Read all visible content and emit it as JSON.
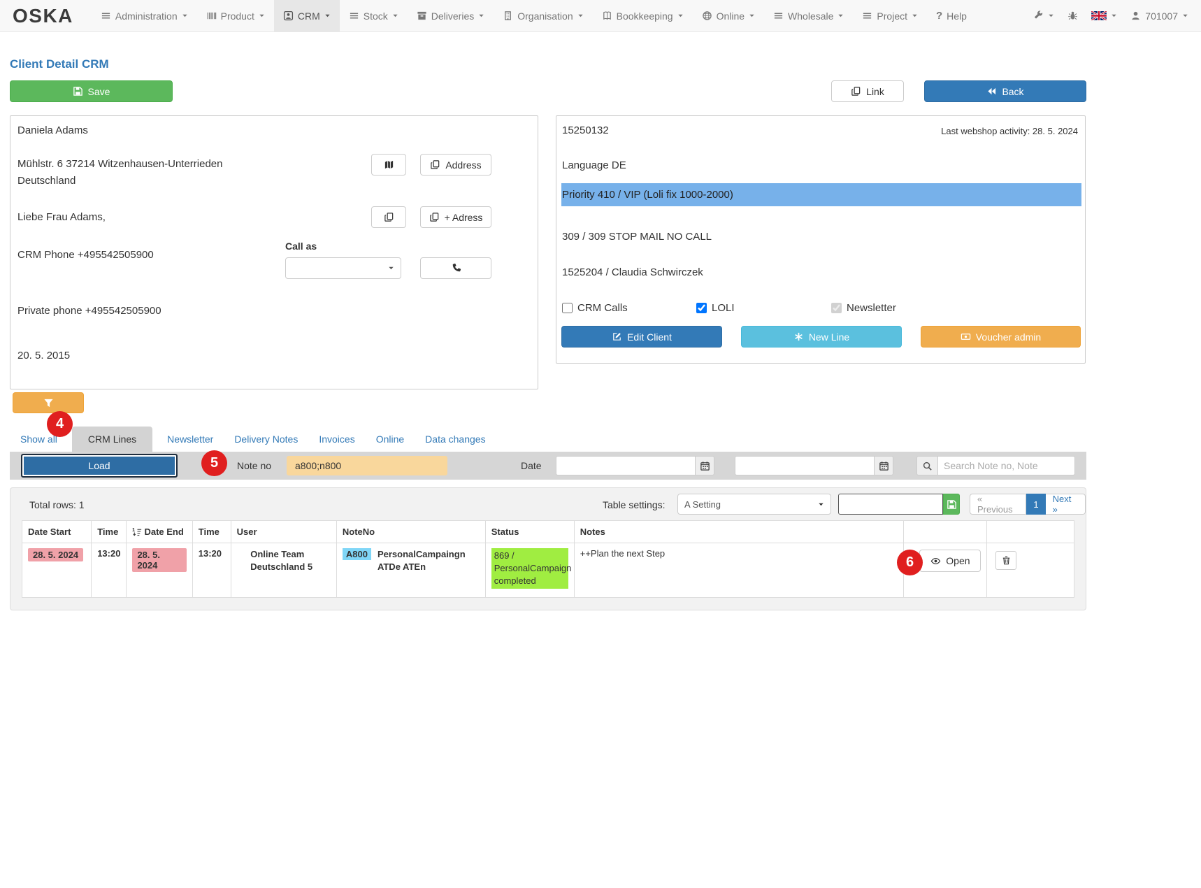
{
  "navbar": {
    "brand": "OSKA",
    "items": [
      {
        "label": "Administration"
      },
      {
        "label": "Product"
      },
      {
        "label": "CRM"
      },
      {
        "label": "Stock"
      },
      {
        "label": "Deliveries"
      },
      {
        "label": "Organisation"
      },
      {
        "label": "Bookkeeping"
      },
      {
        "label": "Online"
      },
      {
        "label": "Wholesale"
      },
      {
        "label": "Project"
      },
      {
        "label": "Help"
      }
    ],
    "user_id": "701007"
  },
  "page": {
    "title": "Client Detail CRM"
  },
  "actions": {
    "save": "Save",
    "link": "Link",
    "back": "Back"
  },
  "client": {
    "name": "Daniela Adams",
    "address_line1": "Mühlstr. 6 37214 Witzenhausen-Unterrieden",
    "address_line2": "Deutschland",
    "salutation": "Liebe Frau Adams,",
    "crm_phone": "CRM Phone +495542505900",
    "private_phone": "Private phone +495542505900",
    "client_since": "20. 5. 2015",
    "call_as_label": "Call as",
    "buttons": {
      "address": "Address",
      "add_address": "+ Adress"
    }
  },
  "account": {
    "client_no": "15250132",
    "last_activity": "Last webshop activity: 28. 5. 2024",
    "language": "Language DE",
    "priority": "Priority 410 / VIP (Loli fix 1000-2000)",
    "stop_mail": "309 / 309 STOP MAIL NO CALL",
    "contact": "1525204 / Claudia Schwirczek",
    "checkboxes": {
      "crm_calls": "CRM Calls",
      "loli": "LOLI",
      "newsletter": "Newsletter"
    },
    "buttons": {
      "edit_client": "Edit Client",
      "new_line": "New Line",
      "voucher_admin": "Voucher admin"
    }
  },
  "tabs": {
    "show_all": "Show all",
    "crm_lines": "CRM Lines",
    "newsletter": "Newsletter",
    "delivery_notes": "Delivery Notes",
    "invoices": "Invoices",
    "online": "Online",
    "data_changes": "Data changes"
  },
  "badges": {
    "step4": "4",
    "step5": "5",
    "step6": "6"
  },
  "filter": {
    "load": "Load",
    "note_no_label": "Note no",
    "note_no_value": "a800;n800",
    "date_label": "Date",
    "search_placeholder": "Search Note no, Note"
  },
  "grid": {
    "total_rows": "Total rows: 1",
    "settings_label": "Table settings:",
    "settings_value": "A Setting",
    "pagination": {
      "previous": "« Previous",
      "page": "1",
      "next": "Next »"
    },
    "headers": [
      "Date Start",
      "Time",
      "Date End",
      "Time",
      "User",
      "NoteNo",
      "Status",
      "Notes"
    ],
    "row": {
      "date_start": "28. 5. 2024",
      "time_start": "13:20",
      "date_end": "28. 5. 2024",
      "time_end": "13:20",
      "user": "Online Team Deutschland 5",
      "note_badge": "A800",
      "note_name": "PersonalCampaingn ATDe ATEn",
      "status": "869 / PersonalCampaign completed",
      "notes": "++Plan the next Step",
      "open": "Open"
    }
  },
  "colors": {
    "accent_blue": "#337ab7",
    "save_green": "#5cb85c",
    "info_cyan": "#5bc0de",
    "warn_orange": "#f0ad4e",
    "badge_red": "#e01f1f",
    "priority_blue": "#77b1ea",
    "load_blue": "#2e6da4",
    "note_input_orange": "#f9d79c",
    "date_pink": "#f0a1a8",
    "note_cyan": "#7fd6f7",
    "status_green": "#a0ed41"
  }
}
